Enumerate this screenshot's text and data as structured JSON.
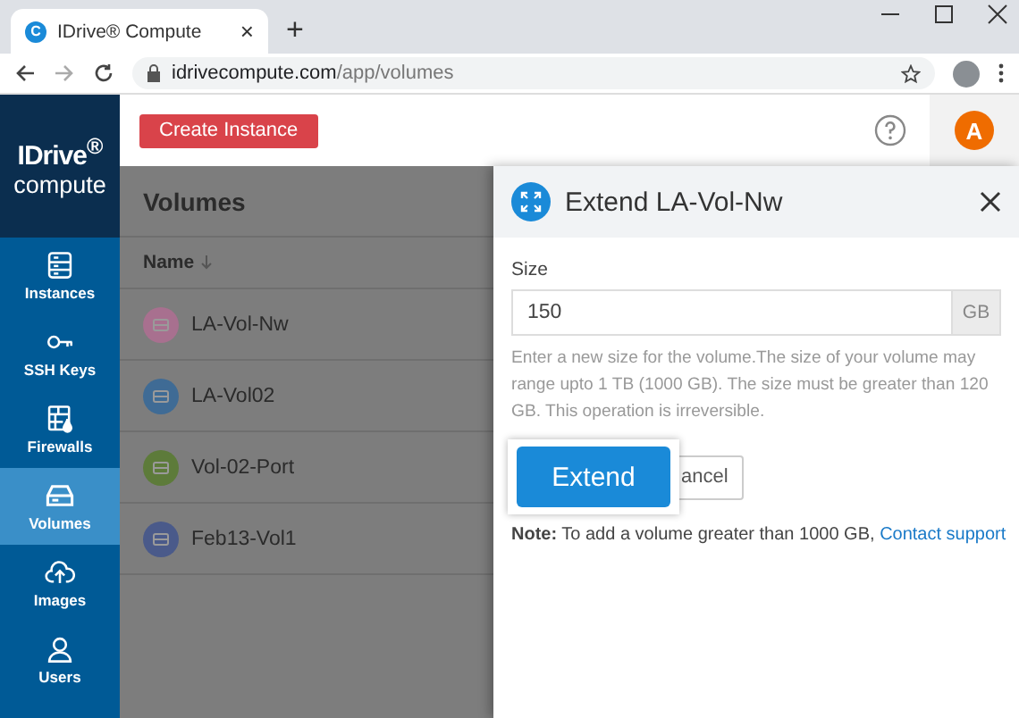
{
  "browser": {
    "tab": {
      "favicon": "C",
      "title": "IDrive® Compute",
      "close": "×"
    },
    "new_tab": "+",
    "address": {
      "domain": "idrivecompute.com",
      "path": "/app/volumes"
    }
  },
  "logo": {
    "brand": "IDrive$^{®}$",
    "product": "compute"
  },
  "sidebar": {
    "items": [
      {
        "label": "Instances",
        "kind": "server",
        "selected": false
      },
      {
        "label": "SSH Keys",
        "kind": "key",
        "selected": false
      },
      {
        "label": "Firewalls",
        "kind": "firewall",
        "selected": false
      },
      {
        "label": "Volumes",
        "kind": "drive",
        "selected": true
      },
      {
        "label": "Images",
        "kind": "cloud",
        "selected": false
      },
      {
        "label": "Users",
        "kind": "user",
        "selected": false
      }
    ]
  },
  "header": {
    "create_button": "Create Instance",
    "avatar": "A"
  },
  "page": {
    "title": "Volumes",
    "column": "Name",
    "rows": [
      {
        "name": "LA-Vol-Nw",
        "color": "#a8708f"
      },
      {
        "name": "LA-Vol02",
        "color": "#3f6b95"
      },
      {
        "name": "Vol-02-Port",
        "color": "#5d7b3a"
      },
      {
        "name": "Feb13-Vol1",
        "color": "#4a5a8a"
      }
    ]
  },
  "panel": {
    "title": "Extend LA-Vol-Nw",
    "size_label": "Size",
    "size_value": "150",
    "unit": "GB",
    "help": "Enter a new size for the volume.The size of your volume may range upto 1 TB (1000 GB). The size must be greater than 120 GB. This operation is irreversible.",
    "extend_button": "Extend",
    "cancel_button": "ancel",
    "note": "**Note:** To add a volume greater than 1000 GB, ",
    "note_link": "Contact support"
  }
}
